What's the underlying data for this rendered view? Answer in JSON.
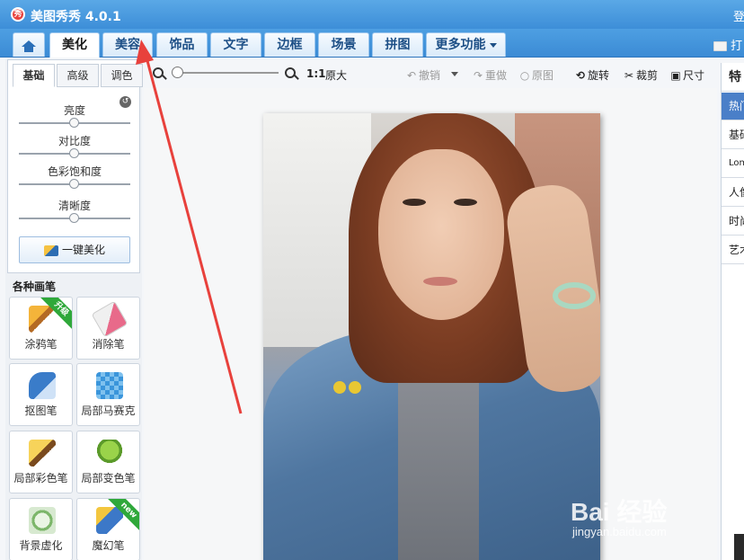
{
  "window": {
    "title": "美图秀秀 4.0.1",
    "logo_text": "秀",
    "login_label": "登"
  },
  "tabs": [
    {
      "label": "美化",
      "active": true
    },
    {
      "label": "美容",
      "active": false
    },
    {
      "label": "饰品",
      "active": false
    },
    {
      "label": "文字",
      "active": false
    },
    {
      "label": "边框",
      "active": false
    },
    {
      "label": "场景",
      "active": false
    },
    {
      "label": "拼图",
      "active": false
    },
    {
      "label": "更多功能",
      "active": false
    }
  ],
  "open_label": "打",
  "left_panel": {
    "subtabs": [
      "基础",
      "高级",
      "调色"
    ],
    "active_subtab": "基础",
    "sliders": [
      {
        "label": "亮度",
        "value": 0.5
      },
      {
        "label": "对比度",
        "value": 0.5
      },
      {
        "label": "色彩饱和度",
        "value": 0.5
      },
      {
        "label": "清晰度",
        "value": 0.5
      }
    ],
    "onekey_label": "一键美化",
    "brush_title": "各种画笔",
    "tools": [
      {
        "label": "涂鸦笔",
        "badge": "升级",
        "icon": "brush-icon"
      },
      {
        "label": "消除笔",
        "badge": "",
        "icon": "eraser-icon"
      },
      {
        "label": "抠图笔",
        "badge": "",
        "icon": "cutout-pen-icon"
      },
      {
        "label": "局部马赛克",
        "badge": "",
        "icon": "mosaic-icon"
      },
      {
        "label": "局部彩色笔",
        "badge": "",
        "icon": "color-brush-icon"
      },
      {
        "label": "局部变色笔",
        "badge": "",
        "icon": "paint-bucket-icon"
      },
      {
        "label": "背景虚化",
        "badge": "",
        "icon": "blur-background-icon"
      },
      {
        "label": "魔幻笔",
        "badge": "new",
        "icon": "magic-wand-icon"
      }
    ]
  },
  "toolbar": {
    "zoom_ratio": "1:1",
    "original_size": "原大",
    "undo": "撤销",
    "redo": "重做",
    "original": "原图",
    "rotate": "旋转",
    "crop": "裁剪",
    "size": "尺寸",
    "zoom_value": 0
  },
  "right_panel": {
    "header": "特",
    "items": [
      {
        "label": "热门",
        "active": true
      },
      {
        "label": "基础",
        "active": false
      },
      {
        "label": "Lomo",
        "active": false
      },
      {
        "label": "人像",
        "active": false
      },
      {
        "label": "时尚",
        "active": false
      },
      {
        "label": "艺术",
        "active": false
      }
    ]
  },
  "watermark": {
    "brand": "Bai 经验",
    "site": "jingyan.baidu.com"
  },
  "colors": {
    "title_bar": "#4a9be0",
    "accent": "#3b8bd5",
    "annotation_arrow": "#e8413c",
    "badge_green": "#2fa83a"
  }
}
